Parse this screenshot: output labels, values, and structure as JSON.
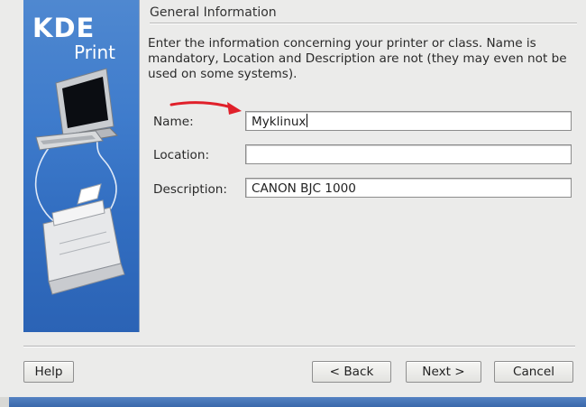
{
  "branding": {
    "kde": "KDE",
    "print": "Print"
  },
  "section": {
    "title": "General Information",
    "intro": "Enter the information concerning your printer or class. Name is mandatory, Location and Description are not (they may even not be used on some systems)."
  },
  "form": {
    "name_label": "Name:",
    "name_value": "Myklinux",
    "location_label": "Location:",
    "location_value": "",
    "description_label": "Description:",
    "description_value": "CANON BJC 1000"
  },
  "buttons": {
    "help": "Help",
    "back": "< Back",
    "next": "Next >",
    "cancel": "Cancel"
  },
  "colors": {
    "annotation_arrow": "#e0202a",
    "sidebar": "#3f7ccc"
  }
}
